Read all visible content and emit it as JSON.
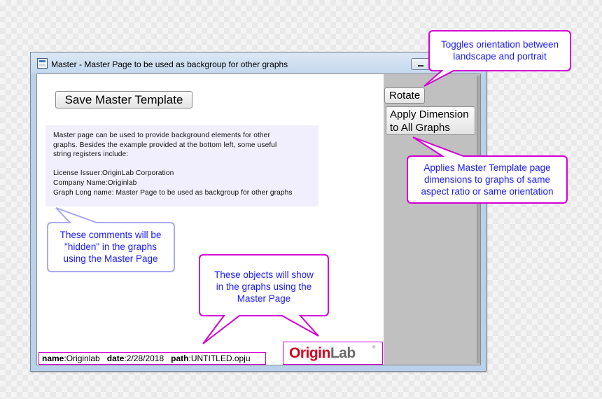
{
  "window": {
    "title": "Master - Master Page to be used as backgroup for other graphs"
  },
  "buttons": {
    "save_master_template": "Save Master Template",
    "rotate": "Rotate",
    "apply_dimension": "Apply Dimension\nto All Graphs"
  },
  "comment": {
    "text": "Master page can be used to provide background elements for other\ngraphs. Besides the example provided at the bottom left, some useful\nstring registers include:\n\nLicense Issuer:OriginLab Corporation\nCompany Name:Originlab\nGraph Long name: Master Page to be used as backgroup for other graphs"
  },
  "info_bar": {
    "name_label": "name",
    "name_value": ":Originlab",
    "date_label": "date",
    "date_value": ":2/28/2018",
    "path_label": "path",
    "path_value": ":UNTITLED.opju"
  },
  "logo": {
    "part1": "Origin",
    "part2": "Lab",
    "reg": "®"
  },
  "callouts": {
    "rotate": "Toggles orientation between\nlandscape and portrait",
    "apply": "Applies Master Template page\ndimensions to graphs of same\naspect ratio or same orientation",
    "comments": "These comments will be\n\"hidden\" in the graphs\nusing the Master Page",
    "objects": "These objects will show\nin the graphs using the\nMaster Page"
  },
  "colors": {
    "callout_border": "#d400d4",
    "callout_text": "#1a1aff",
    "comment_callout_border": "#a9a9f0",
    "comment_background": "#f1effd",
    "logo_red": "#d6001c",
    "logo_gray": "#6b6b6b"
  }
}
